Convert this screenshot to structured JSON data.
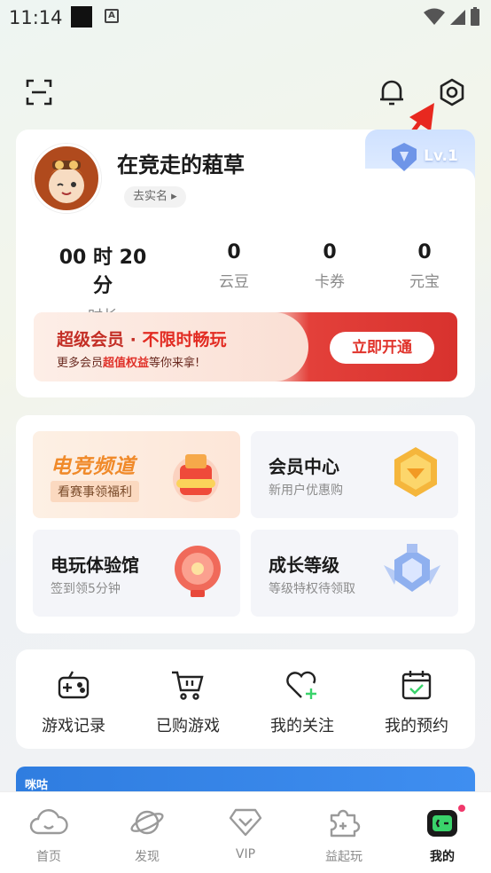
{
  "status_bar": {
    "time": "11:14",
    "a_glyph": "A"
  },
  "top_bar": {
    "scan_icon": "scan-icon",
    "bell_icon": "bell-icon",
    "settings_icon": "settings-icon"
  },
  "profile": {
    "username": "在竞走的蒩草",
    "realname_chip": "去实名 ▸",
    "level": "Lv.1",
    "stats": [
      {
        "value": "00 时 20 分",
        "label": "时长"
      },
      {
        "value": "0",
        "label": "云豆"
      },
      {
        "value": "0",
        "label": "卡券"
      },
      {
        "value": "0",
        "label": "元宝"
      }
    ]
  },
  "vip_banner": {
    "title_a": "超级会员 · ",
    "title_b": "不限时畅玩",
    "sub_a": "更多会员",
    "sub_b": "超值权益",
    "sub_c": "等你来拿!",
    "button": "立即开通"
  },
  "tiles": {
    "esports": {
      "title": "电竞频道",
      "sub": "看赛事领福利"
    },
    "member": {
      "title": "会员中心",
      "sub": "新用户优惠购"
    },
    "arcade": {
      "title": "电玩体验馆",
      "sub": "签到领5分钟"
    },
    "growth": {
      "title": "成长等级",
      "sub": "等级特权待领取"
    }
  },
  "quick_actions": [
    {
      "label": "游戏记录"
    },
    {
      "label": "已购游戏"
    },
    {
      "label": "我的关注"
    },
    {
      "label": "我的预约"
    }
  ],
  "promo": {
    "logo": "咪咕"
  },
  "bottom_nav": [
    {
      "label": "首页"
    },
    {
      "label": "发现"
    },
    {
      "label": "VIP"
    },
    {
      "label": "益起玩"
    },
    {
      "label": "我的"
    }
  ],
  "colors": {
    "accent_red": "#e0322a",
    "vip_gold": "#f08a2a",
    "active_green": "#3ad36b"
  }
}
